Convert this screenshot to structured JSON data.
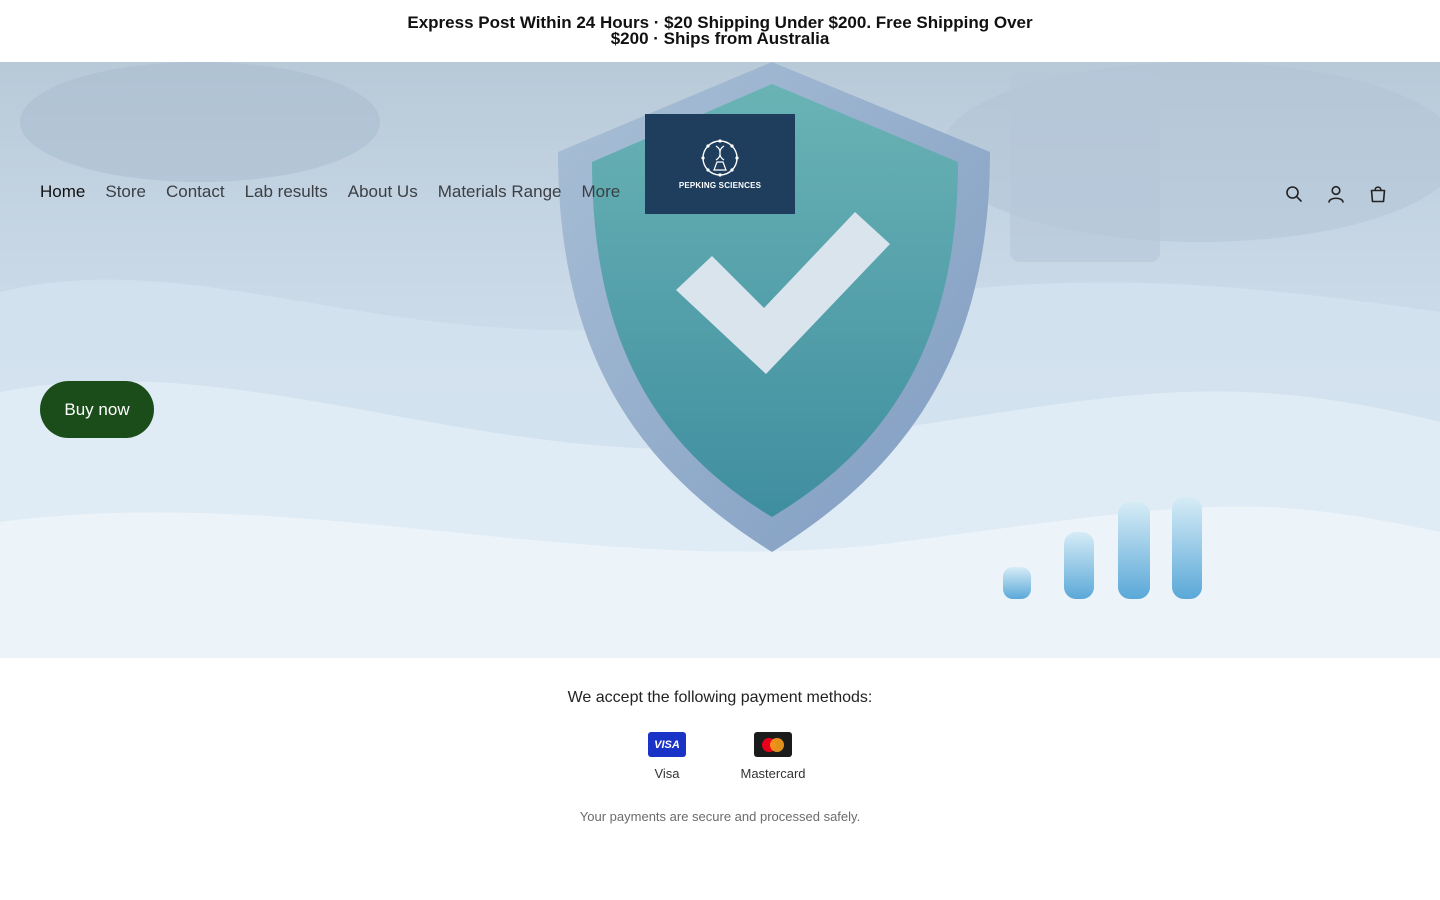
{
  "announcement": {
    "text": "Express Post Within 24 Hours · $20 Shipping Under $200. Free Shipping Over $200 · Ships from Australia"
  },
  "header": {
    "nav": [
      {
        "label": "Home",
        "active": true
      },
      {
        "label": "Store"
      },
      {
        "label": "Contact"
      },
      {
        "label": "Lab results"
      },
      {
        "label": "About Us"
      },
      {
        "label": "Materials Range"
      },
      {
        "label": "More"
      }
    ],
    "logo_text": "PEPKING SCIENCES",
    "icons": [
      "search-icon",
      "account-icon",
      "cart-icon"
    ]
  },
  "hero": {
    "cta_label": "Buy now"
  },
  "payments": {
    "heading": "We accept the following payment methods:",
    "methods": [
      {
        "name": "Visa",
        "badge": "VISA",
        "color": "#1a33c7"
      },
      {
        "name": "Mastercard",
        "color": "#1b1b1b"
      }
    ],
    "note": "Your payments are secure and processed safely."
  },
  "colors": {
    "cta": "#1b4d1b",
    "logo_bg": "#1f3e5e"
  }
}
